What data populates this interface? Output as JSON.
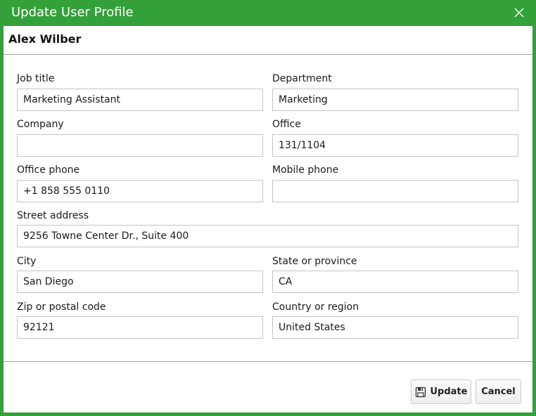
{
  "window": {
    "title": "Update User Profile"
  },
  "profile": {
    "display_name": "Alex Wilber"
  },
  "fields": {
    "job_title": {
      "label": "Job title",
      "value": "Marketing Assistant"
    },
    "department": {
      "label": "Department",
      "value": "Marketing"
    },
    "company": {
      "label": "Company",
      "value": ""
    },
    "office": {
      "label": "Office",
      "value": "131/1104"
    },
    "office_phone": {
      "label": "Office phone",
      "value": "+1 858 555 0110"
    },
    "mobile_phone": {
      "label": "Mobile phone",
      "value": ""
    },
    "street_address": {
      "label": "Street address",
      "value": "9256 Towne Center Dr., Suite 400"
    },
    "city": {
      "label": "City",
      "value": "San Diego"
    },
    "state": {
      "label": "State or province",
      "value": "CA"
    },
    "zip": {
      "label": "Zip or postal code",
      "value": "92121"
    },
    "country": {
      "label": "Country or region",
      "value": "United States"
    }
  },
  "actions": {
    "update_label": "Update",
    "cancel_label": "Cancel"
  },
  "icons": {
    "close": "close-icon",
    "save": "save-icon"
  },
  "colors": {
    "titlebar": "#34a03a",
    "border": "#c4c4c4"
  }
}
